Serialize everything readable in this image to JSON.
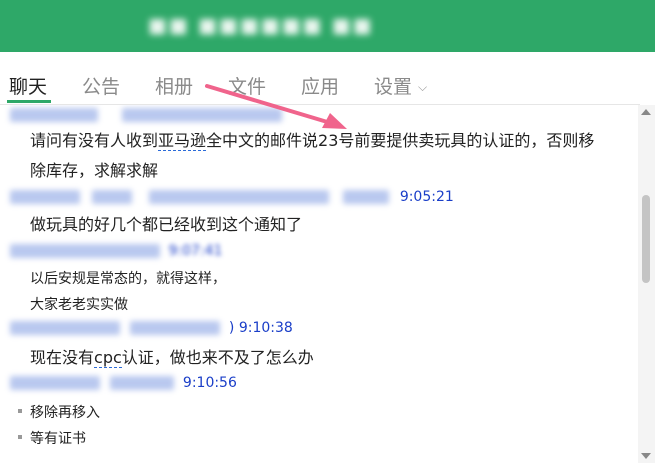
{
  "window": {
    "title": "■■ ■■■■■■ ■■"
  },
  "tabs": [
    {
      "label": "聊天"
    },
    {
      "label": "公告"
    },
    {
      "label": "相册"
    },
    {
      "label": "文件"
    },
    {
      "label": "应用"
    },
    {
      "label": "设置"
    }
  ],
  "messages": [
    {
      "time": "",
      "lines": [
        "请问有没有人收到亚马逊全中文的邮件说23号前要提供卖玩具的认证的，否则移",
        "除库存，求解求解"
      ],
      "link_text": "亚马逊",
      "line1_before": "请问有没有人收到",
      "line1_after": "全中文的邮件说23号前要提供卖玩具的认证的，否则移"
    },
    {
      "time": "9:05:21",
      "text": "做玩具的好几个都已经收到这个通知了"
    },
    {
      "time": "9:07:41",
      "lines": [
        "以后安规是常态的，就得这样，",
        "大家老老实实做"
      ]
    },
    {
      "time": "9:10:38",
      "before": "现在没有",
      "link_text": "cpc",
      "after": "认证，做也来不及了怎么办"
    },
    {
      "time": "9:10:56",
      "bullets": [
        "移除再移入",
        "等有证书"
      ]
    }
  ],
  "colors": {
    "titlebar": "#2ea868",
    "accent": "#2ea868",
    "sender": "#1a3ec8",
    "annotation_arrow": "#f0648c"
  },
  "icons": {
    "settings_dropdown": "chevron-down-icon",
    "annotation": "arrow-icon"
  }
}
